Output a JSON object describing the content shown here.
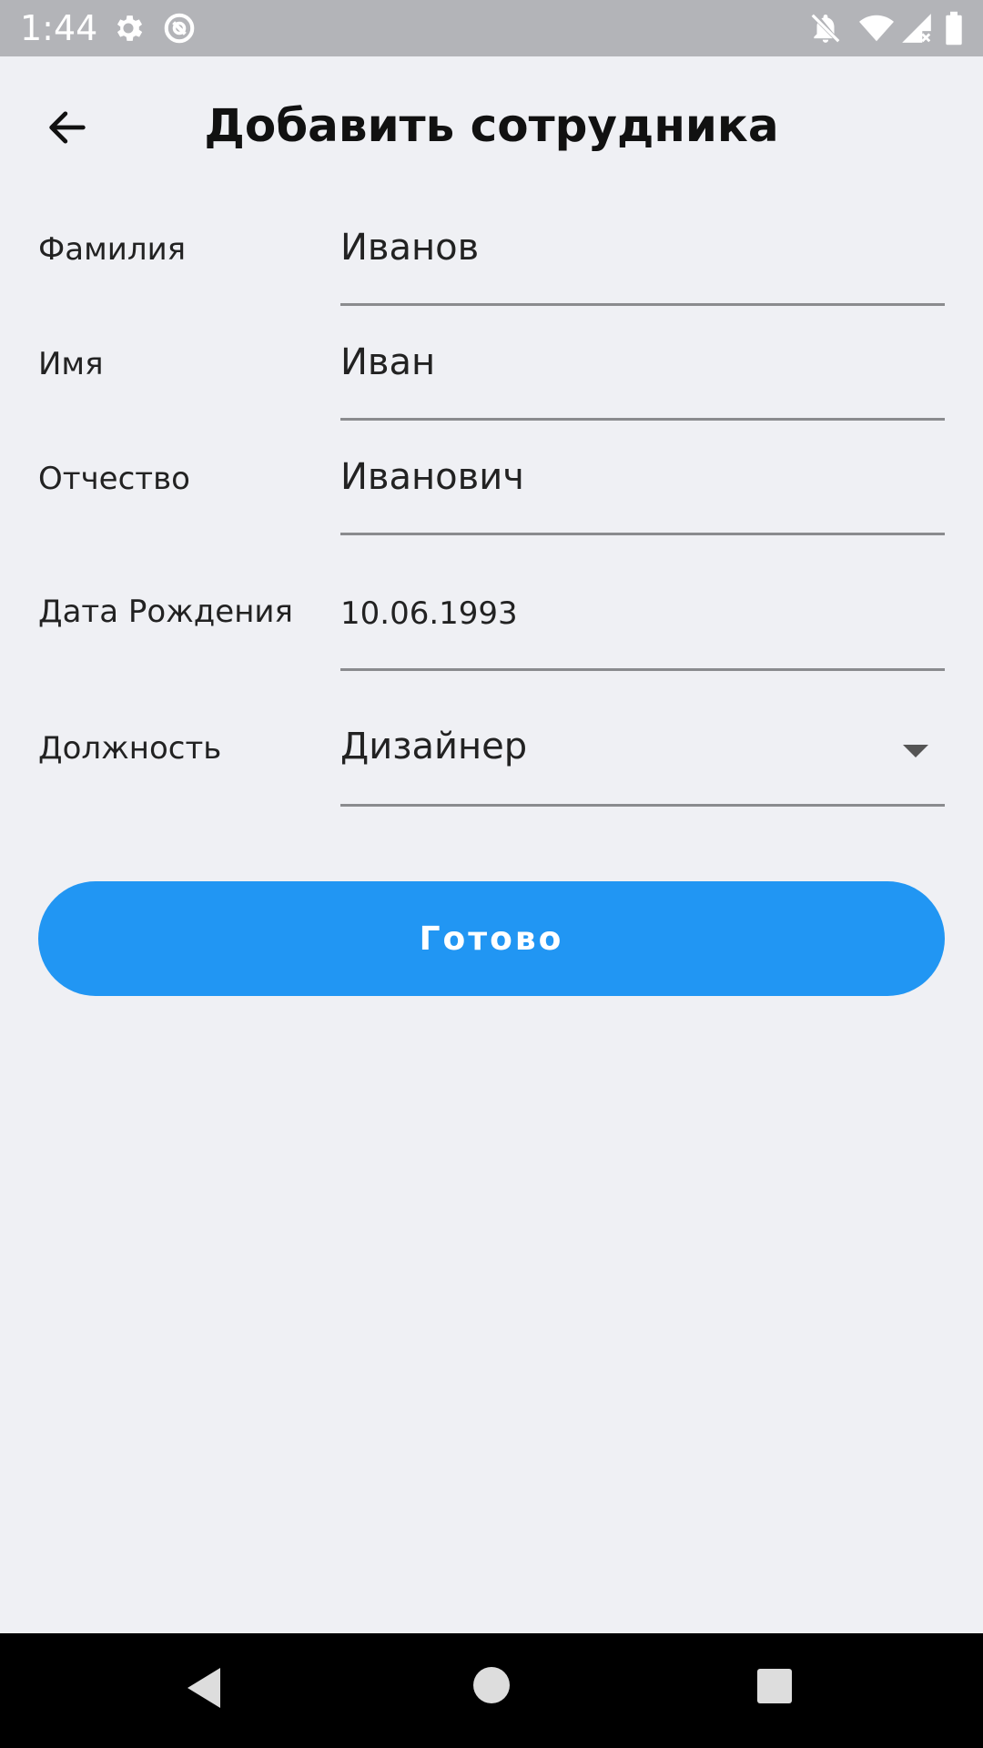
{
  "status_bar": {
    "time": "1:44",
    "icons": [
      "gear-icon",
      "sync-icon",
      "bell-off-icon",
      "wifi-icon",
      "signal-icon",
      "battery-icon"
    ]
  },
  "app_bar": {
    "back_icon": "arrow-left-icon",
    "title": "Добавить сотрудника"
  },
  "form": {
    "last_name": {
      "label": "Фамилия",
      "value": "Иванов"
    },
    "first_name": {
      "label": "Имя",
      "value": "Иван"
    },
    "patronymic": {
      "label": "Отчество",
      "value": "Иванович"
    },
    "birth_date": {
      "label": "Дата Рождения",
      "value": "10.06.1993"
    },
    "position": {
      "label": "Должность",
      "value": "Дизайнер"
    }
  },
  "done_button": {
    "label": "Готово"
  },
  "colors": {
    "background": "#EFF0F4",
    "status_bar": "#B3B4B8",
    "accent": "#2196F3",
    "underline": "#8A8B8E",
    "nav_bar": "#000000"
  },
  "nav_bar": {
    "icons": [
      "back-triangle-icon",
      "home-circle-icon",
      "recents-square-icon"
    ]
  }
}
